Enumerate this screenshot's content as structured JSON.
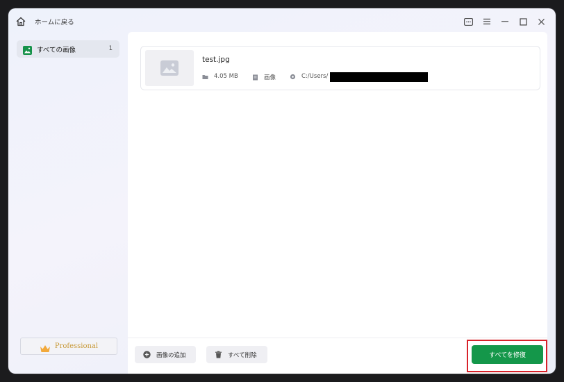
{
  "titlebar": {
    "back_label": "ホームに戻る",
    "icons": [
      "home-icon",
      "feedback-icon",
      "menu-icon",
      "minimize-icon",
      "maximize-icon",
      "close-icon"
    ]
  },
  "sidebar": {
    "items": [
      {
        "label": "すべての画像",
        "count": "1",
        "icon": "image-icon"
      }
    ],
    "professional_label": "Professional"
  },
  "files": [
    {
      "name": "test.jpg",
      "size": "4.05 MB",
      "type": "画像",
      "path": "C:/Users/"
    }
  ],
  "footer": {
    "add_label": "画像の追加",
    "delete_label": "すべて削除",
    "repair_label": "すべてを修復"
  },
  "colors": {
    "accent_green": "#14974a",
    "highlight_red": "#d8222a",
    "pro_gold": "#c89a3a"
  }
}
